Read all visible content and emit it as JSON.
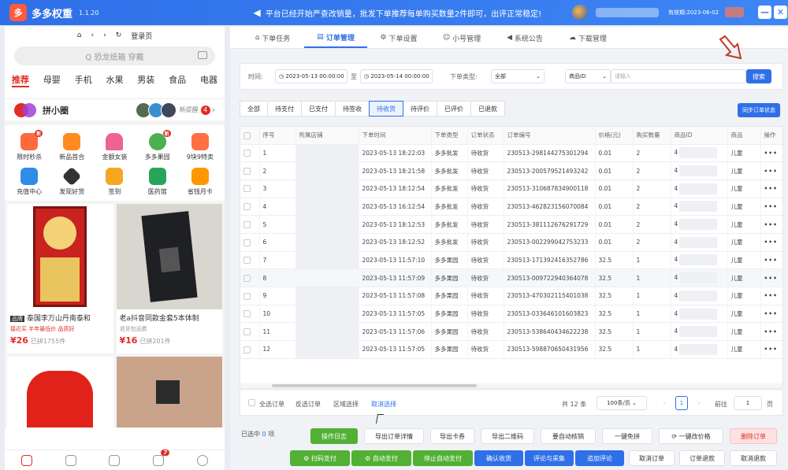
{
  "titlebar": {
    "logo_char": "多",
    "app_name": "多多权重",
    "version": "1.1.20",
    "notice": "平台已经开始严查改销量，批发下单推荐每单购买数量2件即可，出评正常稳定!",
    "expire": "有效期:2023-06-02",
    "btn_min": "—",
    "btn_close": "✕"
  },
  "left": {
    "nav": {
      "home": "⌂",
      "back": "‹",
      "forward": "›",
      "refresh": "↻",
      "login": "登录页"
    },
    "search_placeholder": "Q 恐龙纸箱 穿戴",
    "categories": [
      "推荐",
      "母婴",
      "手机",
      "水果",
      "男装",
      "食品",
      "电器"
    ],
    "pxq": {
      "title": "拼小圈",
      "new": "新提醒",
      "badge": "4",
      "chevron": "›"
    },
    "icons": [
      {
        "label": "限时秒杀",
        "color": "#ff6a3d",
        "badge": "新"
      },
      {
        "label": "新品首合",
        "color": "#ff8a1f",
        "badge": ""
      },
      {
        "label": "金额女装",
        "color": "#f06292",
        "badge": ""
      },
      {
        "label": "多多果园",
        "color": "#4caf50",
        "badge": "新"
      },
      {
        "label": "9块9特卖",
        "color": "#ff7043",
        "badge": ""
      },
      {
        "label": "充值中心",
        "color": "#2f8de8",
        "badge": ""
      },
      {
        "label": "发现好货",
        "color": "#333333",
        "badge": ""
      },
      {
        "label": "签到",
        "color": "#f5a623",
        "badge": ""
      },
      {
        "label": "医药馆",
        "color": "#26a65b",
        "badge": ""
      },
      {
        "label": "省钱月卡",
        "color": "#ff9800",
        "badge": ""
      }
    ],
    "products": [
      {
        "title": "泰国李万山丹南泰和",
        "tag": "接近买 半年最低价 品质好",
        "price": "¥26",
        "sold": "已拼1755件",
        "tagbadge": "品牌"
      },
      {
        "title": "老a抖音同款金套5本体制",
        "tag": "退货包运费",
        "price": "¥16",
        "sold": "已拼201件",
        "tagbadge": ""
      }
    ],
    "bottom_badge": "7"
  },
  "tabs": [
    "下单任务",
    "订单管理",
    "下单设置",
    "小号管理",
    "系统公告",
    "下载管理"
  ],
  "tab_icons": [
    "⌂",
    "▤",
    "⚙",
    "☺",
    "◀",
    "☁"
  ],
  "filter": {
    "time_label": "时间:",
    "start": "2023-05-13 00:00:00",
    "to": "至",
    "end": "2023-05-14 00:00:00",
    "type_label": "下单类型:",
    "type_value": "全部",
    "field_value": "商品ID",
    "input_placeholder": "请输入",
    "search_btn": "搜索"
  },
  "status_tabs": [
    "全部",
    "待支付",
    "已支付",
    "待签收",
    "待收货",
    "待评价",
    "已评价",
    "已退款"
  ],
  "sync_btn": "同步订单状态",
  "table": {
    "headers": [
      "",
      "序号",
      "所属店铺",
      "下单时间",
      "下单类型",
      "订单状态",
      "订单编号",
      "价格(元)",
      "购买数量",
      "商品ID",
      "商品",
      "操作"
    ],
    "rows": [
      [
        "1",
        "2023-05-13 18:22:03",
        "多多批发",
        "待收货",
        "230513-298144275301294",
        "0.01",
        "2",
        "4",
        "儿童"
      ],
      [
        "2",
        "2023-05-13 18:21:58",
        "多多批发",
        "待收货",
        "230513-200579521493242",
        "0.01",
        "2",
        "4",
        "儿童"
      ],
      [
        "3",
        "2023-05-13 18:12:54",
        "多多批发",
        "待收货",
        "230513-310687834900118",
        "0.01",
        "2",
        "4",
        "儿童"
      ],
      [
        "4",
        "2023-05-13 16:12:54",
        "多多批发",
        "待收货",
        "230513-462823156070084",
        "0.01",
        "2",
        "4",
        "儿童"
      ],
      [
        "5",
        "2023-05-13 18:12:53",
        "多多批发",
        "待收货",
        "230513-381112676291729",
        "0.01",
        "2",
        "4",
        "儿童"
      ],
      [
        "6",
        "2023-05-13 18:12:52",
        "多多批发",
        "待收货",
        "230513-002299042753233",
        "0.01",
        "2",
        "4",
        "儿童"
      ],
      [
        "7",
        "2023-05-13 11:57:10",
        "多多果园",
        "待收货",
        "230513-171392416352786",
        "32.5",
        "1",
        "4",
        "儿童"
      ],
      [
        "8",
        "2023-05-13 11:57:09",
        "多多果园",
        "待收货",
        "230513-009722940364078",
        "32.5",
        "1",
        "4",
        "儿童"
      ],
      [
        "9",
        "2023-05-13 11:57:08",
        "多多果园",
        "待收货",
        "230513-470302115401038",
        "32.5",
        "1",
        "4",
        "儿童"
      ],
      [
        "10",
        "2023-05-13 11:57:05",
        "多多果园",
        "待收货",
        "230513-033646101603823",
        "32.5",
        "1",
        "4",
        "儿童"
      ],
      [
        "11",
        "2023-05-13 11:57:06",
        "多多果园",
        "待收货",
        "230513-538640434622238",
        "32.5",
        "1",
        "4",
        "儿童"
      ],
      [
        "12",
        "2023-05-13 11:57:05",
        "多多果园",
        "待收货",
        "230513-598870650431956",
        "32.5",
        "1",
        "4",
        "儿童"
      ]
    ],
    "more": "•••"
  },
  "footer": {
    "select_all": "全选订单",
    "invert": "反选订单",
    "range": "区域选择",
    "cancel": "取消选择",
    "total": "共 12 条",
    "page_size": "100条/页",
    "prev": "‹",
    "page": "1",
    "next": "›",
    "goto": "前往",
    "goto_value": "1",
    "page_unit": "页"
  },
  "actions": {
    "selected_label": "已选中",
    "selected_count": "0",
    "selected_unit": "项",
    "row1": [
      "操作日志",
      "导出订单详情",
      "导出卡券",
      "导出二维码",
      "要自动核销",
      "一键免拼",
      "一键改价格",
      "删除订单"
    ],
    "row2": [
      "扫码支付",
      "自动支付",
      "停止自动支付",
      "确认收货",
      "评论与采集",
      "追加评论",
      "取消订单",
      "订单退款",
      "取消退款"
    ]
  }
}
